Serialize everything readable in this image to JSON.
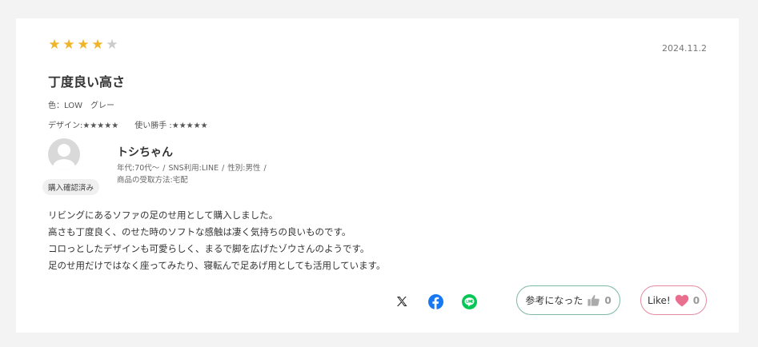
{
  "review": {
    "rating": 4,
    "rating_max": 5,
    "date": "2024.11.2",
    "title": "丁度良い高さ",
    "variant": "色：LOW　グレー",
    "design_rating": "デザイン:★★★★★",
    "usability_rating": "使い勝手 :★★★★★",
    "body_lines": [
      "リビングにあるソファの足のせ用として購入しました。",
      "高さも丁度良く、のせた時のソフトな感触は凄く気持ちの良いものです。",
      "コロっとしたデザインも可愛らしく、まるで脚を広げたゾウさんのようです。",
      "足のせ用だけではなく座ってみたり、寝転んで足あげ用としても活用しています。"
    ]
  },
  "reviewer": {
    "badge": "購入確認済み",
    "name": "トシちゃん",
    "age": "年代:70代～",
    "sns": "SNS利用:LINE",
    "gender": "性別:男性",
    "receipt": "商品の受取方法:宅配"
  },
  "actions": {
    "helpful_label": "参考になった",
    "helpful_count": "0",
    "like_label": "Like!",
    "like_count": "0"
  },
  "share": {
    "icons": [
      "x-icon",
      "facebook-icon",
      "line-icon"
    ]
  },
  "colors": {
    "star_on": "#f0b429",
    "star_off": "#cccccc",
    "facebook": "#1877f2",
    "line": "#06c755",
    "helpful_border": "#7fb8a8",
    "like_border": "#e48aa0",
    "heart": "#e8708e"
  }
}
